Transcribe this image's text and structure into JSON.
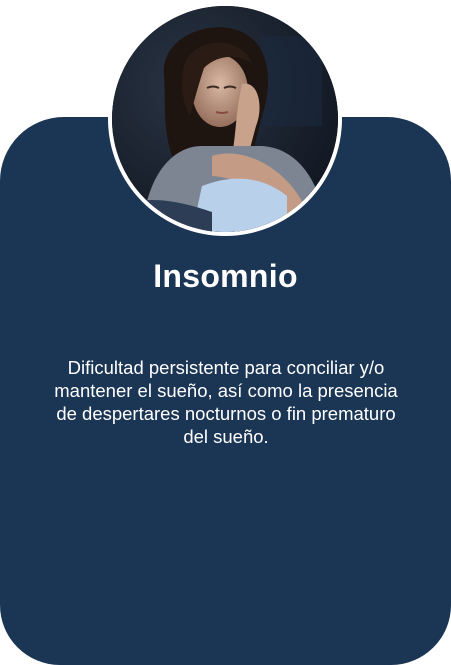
{
  "card": {
    "title": "Insomnio",
    "description": "Dificultad persistente para conciliar y/o mantener el sueño, así como la presencia de despertares nocturnos o fin prematuro del sueño.",
    "background_color": "#1b3554"
  },
  "image": {
    "icon": "person-insomnia-photo"
  }
}
